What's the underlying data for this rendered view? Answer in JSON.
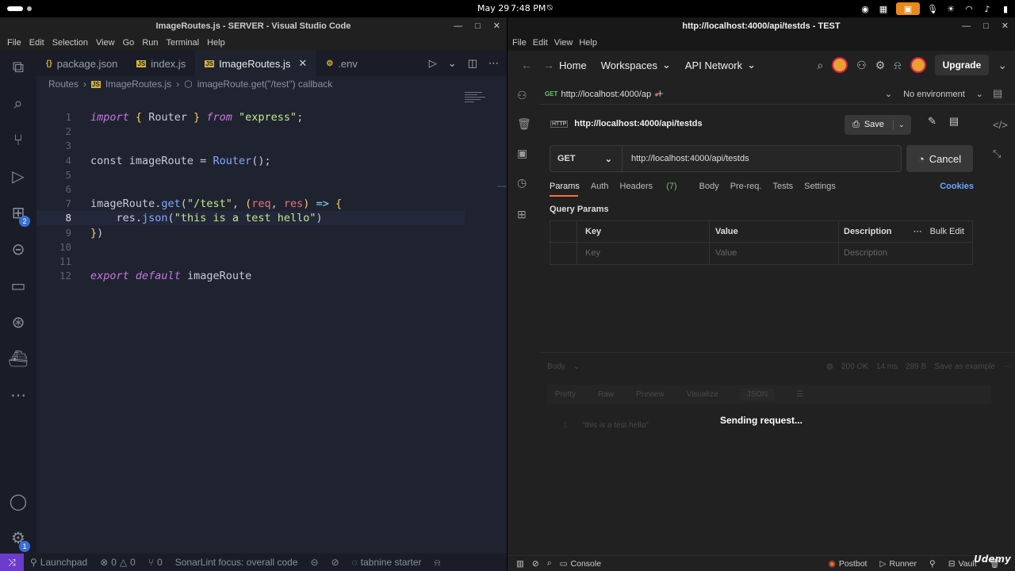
{
  "topbar": {
    "date": "May 29",
    "time": "7:48 PM"
  },
  "vscode": {
    "title": "ImageRoutes.js - SERVER - Visual Studio Code",
    "menu": [
      "File",
      "Edit",
      "Selection",
      "View",
      "Go",
      "Run",
      "Terminal",
      "Help"
    ],
    "tabs": [
      {
        "label": "package.json",
        "icon": "json-icon"
      },
      {
        "label": "index.js",
        "icon": "js-icon"
      },
      {
        "label": "ImageRoutes.js",
        "icon": "js-icon",
        "active": true
      },
      {
        "label": ".env",
        "icon": "env-icon"
      }
    ],
    "breadcrumb": [
      "Routes",
      "ImageRoutes.js",
      "imageRoute.get(\"/test\") callback"
    ],
    "extensions_badge": "2",
    "settings_badge": "1",
    "line_numbers": [
      "1",
      "2",
      "3",
      "4",
      "5",
      "6",
      "7",
      "8",
      "9",
      "10",
      "11",
      "12"
    ],
    "current_line": "8",
    "status": {
      "launchpad": "Launchpad",
      "errors": "0",
      "warnings": "0",
      "ports": "0",
      "sonarlint": "SonarLint focus: overall code",
      "tabnine": "tabnine starter"
    }
  },
  "postman": {
    "title": "http://localhost:4000/api/testds - TEST",
    "menu": [
      "File",
      "Edit",
      "View",
      "Help"
    ],
    "nav": {
      "home": "Home",
      "workspaces": "Workspaces",
      "api_network": "API Network",
      "upgrade": "Upgrade"
    },
    "request_tab": {
      "method": "GET",
      "label": "http://localhost:4000/ap"
    },
    "environment": "No environment",
    "request_name": "http://localhost:4000/api/testds",
    "http_badge": "HTTP",
    "save_label": "Save",
    "method": "GET",
    "url": "http://localhost:4000/api/testds",
    "cancel_label": "Cancel",
    "req_tabs": {
      "params": "Params",
      "auth": "Auth",
      "headers": "Headers",
      "headers_count": "(7)",
      "body": "Body",
      "prereq": "Pre-req.",
      "tests": "Tests",
      "settings": "Settings",
      "cookies": "Cookies"
    },
    "query_params_label": "Query Params",
    "table": {
      "headers": {
        "key": "Key",
        "value": "Value",
        "description": "Description",
        "bulk_edit": "Bulk Edit"
      },
      "placeholders": {
        "key": "Key",
        "value": "Value",
        "description": "Description"
      }
    },
    "response": {
      "body_label": "Body",
      "status": "200 OK",
      "time": "14 ms",
      "size": "289 B",
      "save_label": "Save as example",
      "tabs": {
        "pretty": "Pretty",
        "raw": "Raw",
        "preview": "Preview",
        "visualize": "Visualize",
        "json": "JSON"
      },
      "line": "1",
      "body_text": "\"this is a test hello\""
    },
    "sending": "Sending request...",
    "status": {
      "console": "Console",
      "postbot": "Postbot",
      "runner": "Runner",
      "vault": "Vault"
    }
  },
  "watermark": "Udemy",
  "colors": {
    "accent": "#ff6c37",
    "vscode_bg": "#1f2330",
    "remote": "#6b3bc9"
  }
}
